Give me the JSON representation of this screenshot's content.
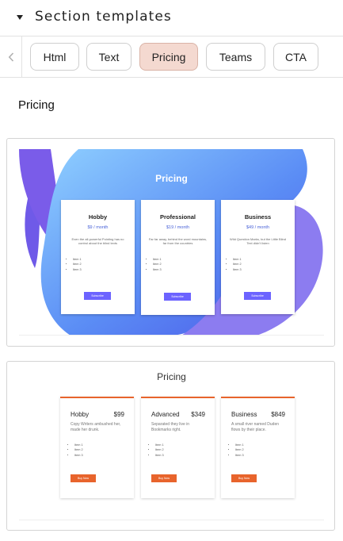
{
  "header": {
    "title": "Section templates",
    "caret_icon": "caret-down-icon"
  },
  "tabs": {
    "scroll_icon": "chevron-left-icon",
    "items": [
      {
        "label": "Html"
      },
      {
        "label": "Text"
      },
      {
        "label": "Pricing",
        "active": true
      },
      {
        "label": "Teams"
      },
      {
        "label": "CTA"
      }
    ]
  },
  "category_heading": "Pricing",
  "template1": {
    "title": "Pricing",
    "colors": {
      "gradient_start": "#7fc4ff",
      "gradient_end": "#4b57e8",
      "blob_purple": "#8c7cf0",
      "button": "#6c63ff"
    },
    "plans": [
      {
        "name": "Hobby",
        "price": "$9 / month",
        "description": "Even the all-powerful Pointing has no control about the blind texts",
        "items": [
          "Item 1",
          "Item 2",
          "Item 3"
        ],
        "button": "Subscribe"
      },
      {
        "name": "Professional",
        "price": "$19 / month",
        "description": "Far far away, behind the word mountains, far from the countries",
        "items": [
          "Item 1",
          "Item 2",
          "Item 3"
        ],
        "button": "Subscribe"
      },
      {
        "name": "Business",
        "price": "$49 / month",
        "description": "Wild Question Marks, but the Little Blind Text didn't listen",
        "items": [
          "Item 1",
          "Item 2",
          "Item 3"
        ],
        "button": "Subscribe"
      }
    ]
  },
  "template2": {
    "title": "Pricing",
    "colors": {
      "accent": "#e8642c"
    },
    "plans": [
      {
        "name": "Hobby",
        "price": "$99",
        "description": "Copy Writers ambushed her, made her drunk.",
        "items": [
          "Item 1",
          "Item 2",
          "Item 3"
        ],
        "button": "Buy Now"
      },
      {
        "name": "Advanced",
        "price": "$349",
        "description": "Separated they live in Bookmarks right.",
        "items": [
          "Item 1",
          "Item 2",
          "Item 3"
        ],
        "button": "Buy Now"
      },
      {
        "name": "Business",
        "price": "$849",
        "description": "A small river named Duden flows by their place.",
        "items": [
          "Item 1",
          "Item 2",
          "Item 3"
        ],
        "button": "Buy Now"
      }
    ]
  }
}
